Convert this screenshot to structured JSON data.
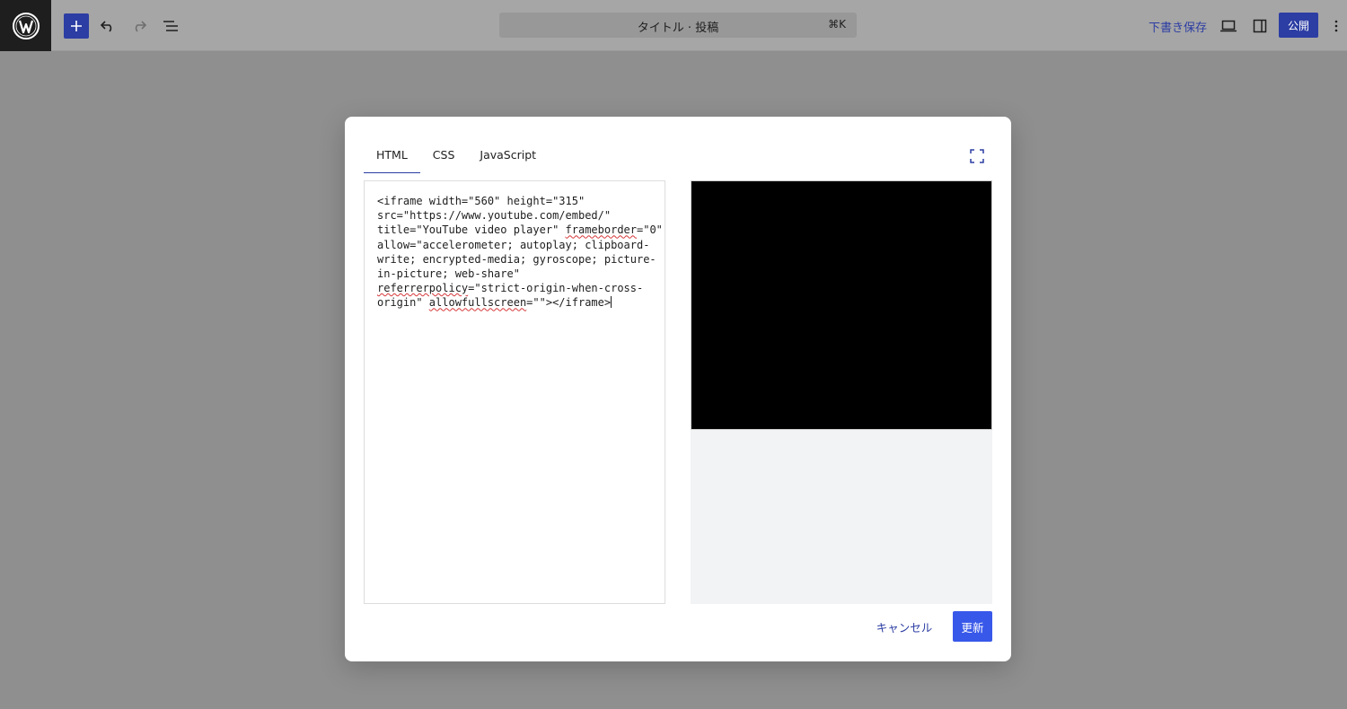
{
  "toolbar": {
    "document_title": "タイトル · 投稿",
    "shortcut": "⌘K",
    "save_draft_label": "下書き保存",
    "publish_label": "公開"
  },
  "modal": {
    "tabs": [
      {
        "label": "HTML",
        "active": true
      },
      {
        "label": "CSS",
        "active": false
      },
      {
        "label": "JavaScript",
        "active": false
      }
    ],
    "code_lines": [
      "<iframe width=\"560\" height=\"315\"",
      "src=\"https://www.youtube.com/embed/\"",
      "title=\"YouTube video player\" frameborder=\"0\"",
      "allow=\"accelerometer; autoplay; clipboard-",
      "write; encrypted-media; gyroscope; picture-",
      "in-picture; web-share\"",
      "referrerpolicy=\"strict-origin-when-cross-",
      "origin\" allowfullscreen=\"\"></iframe>"
    ],
    "cancel_label": "キャンセル",
    "update_label": "更新"
  },
  "colors": {
    "accent": "#2c3da3",
    "primary_button": "#3858e9",
    "backdrop": "#8f8f8f"
  }
}
